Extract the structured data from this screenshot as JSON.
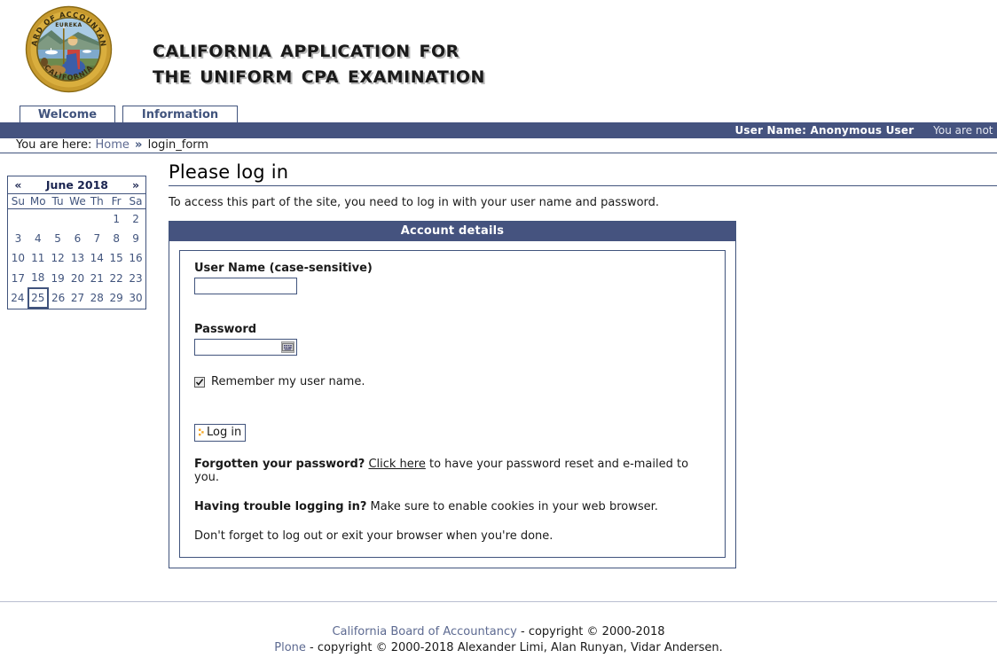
{
  "header": {
    "title_line1": "California Application for",
    "title_line2": "the Uniform CPA Examination",
    "seal": {
      "top_text": "BOARD OF ACCOUNTANCY",
      "bottom_text": "CALIFORNIA",
      "motto": "EUREKA"
    }
  },
  "tabs": [
    {
      "label": "Welcome"
    },
    {
      "label": "Information"
    }
  ],
  "userbar": {
    "user_name": "User Name: Anonymous User",
    "status": "You are not logged in"
  },
  "breadcrumb": {
    "prefix": "You are here:",
    "home": "Home",
    "separator": "»",
    "current": "login_form"
  },
  "calendar": {
    "prev": "«",
    "next": "»",
    "month_year": "June 2018",
    "daynames": [
      "Su",
      "Mo",
      "Tu",
      "We",
      "Th",
      "Fr",
      "Sa"
    ],
    "weeks": [
      [
        "",
        "",
        "",
        "",
        "",
        "1",
        "2"
      ],
      [
        "3",
        "4",
        "5",
        "6",
        "7",
        "8",
        "9"
      ],
      [
        "10",
        "11",
        "12",
        "13",
        "14",
        "15",
        "16"
      ],
      [
        "17",
        "18",
        "19",
        "20",
        "21",
        "22",
        "23"
      ],
      [
        "24",
        "25",
        "26",
        "27",
        "28",
        "29",
        "30"
      ]
    ],
    "today": "25"
  },
  "main": {
    "page_title": "Please log in",
    "intro": "To access this part of the site, you need to log in with your user name and password.",
    "legend": "Account details",
    "username_label": "User Name (case-sensitive)",
    "username_value": "",
    "password_label": "Password",
    "password_value": "",
    "keyboard_icon": "keyboard-icon",
    "remember_label": "Remember my user name.",
    "remember_checked": true,
    "login_button": "Log in",
    "forgot_bold": "Forgotten your password?",
    "forgot_link": "Click here",
    "forgot_rest": " to have your password reset and e-mailed to you.",
    "trouble_bold": "Having trouble logging in?",
    "trouble_rest": " Make sure to enable cookies in your web browser.",
    "logout_note": "Don't forget to log out or exit your browser when you're done."
  },
  "footer": {
    "line1_link": "California Board of Accountancy",
    "line1_rest": " - copyright © 2000-2018",
    "line2_link": "Plone",
    "line2_rest": " - copyright © 2000-2018 Alexander Limi, Alan Runyan, Vidar Andersen."
  },
  "colors": {
    "navy": "#45537F",
    "border_navy": "#41547D",
    "link_gray_blue": "#5d6a91",
    "seal_gold": "#C79A2E",
    "accent_orange": "#F5A623"
  }
}
